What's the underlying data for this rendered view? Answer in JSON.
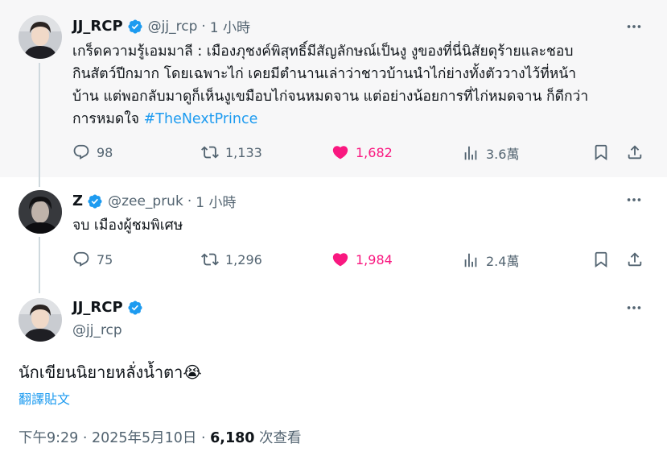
{
  "tweets": [
    {
      "name": "JJ_RCP",
      "handle": "@jj_rcp",
      "time": "1 小時",
      "text_lines": [
        "เกร็ดความรู้เอมมาลี : เมืองภุชงค์พิสุทธิ์มีสัญลักษณ์เป็นงู งูของที่นี่นิสัยดุร้ายและชอบ",
        "กินสัตว์ปีกมาก โดยเฉพาะไก่ เคยมีตำนานเล่าว่าชาวบ้านนำไก่ย่างทั้งตัววางไว้ที่หน้า",
        "บ้าน แต่พอกลับมาดูก็เห็นงูเขมือบไก่จนหมดจาน แต่อย่างน้อยการที่ไก่หมดจาน ก็ดีกว่า"
      ],
      "text_last": "การหมดใจ ",
      "hashtag": "#TheNextPrince",
      "replies": "98",
      "retweets": "1,133",
      "likes": "1,682",
      "views": "3.6萬"
    },
    {
      "name": "Z",
      "handle": "@zee_pruk",
      "time": "1 小時",
      "text": "จบ เมืองผู้ชมพิเศษ",
      "replies": "75",
      "retweets": "1,296",
      "likes": "1,984",
      "views": "2.4萬"
    }
  ],
  "main_tweet": {
    "name": "JJ_RCP",
    "handle": "@jj_rcp",
    "text": "นักเขียนนิยายหลั่งน้ำตา",
    "emoji": "😭",
    "translate_label": "翻譯貼文",
    "timestamp": "下午9:29 · 2025年5月10日 · ",
    "views_count": "6,180",
    "views_label": " 次查看"
  },
  "icons": {
    "verified": "verified-badge-icon",
    "more": "more-icon",
    "reply": "reply-icon",
    "retweet": "retweet-icon",
    "like": "heart-icon",
    "views": "views-chart-icon",
    "bookmark": "bookmark-icon",
    "share": "share-icon"
  },
  "colors": {
    "accent": "#1d9bf0",
    "like": "#f91880",
    "muted": "#536471",
    "text": "#0f1419"
  }
}
